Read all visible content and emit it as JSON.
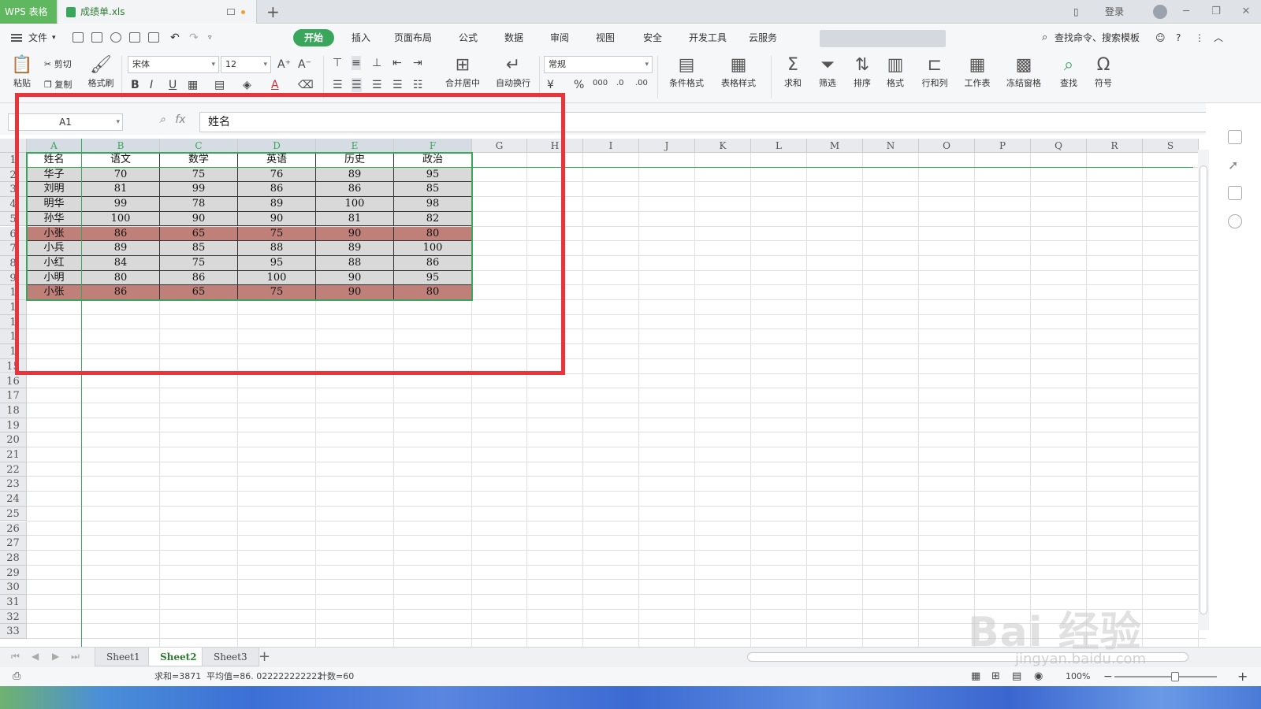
{
  "titlebar": {
    "app_tab": "WPS 表格",
    "doc_tab": "成绩单.xls",
    "login": "登录"
  },
  "menubar": {
    "file": "文件",
    "tabs": [
      "开始",
      "插入",
      "页面布局",
      "公式",
      "数据",
      "审阅",
      "视图",
      "安全",
      "开发工具",
      "云服务"
    ],
    "search": "查找命令、搜索模板"
  },
  "toolbar": {
    "paste": "粘贴",
    "cut": "剪切",
    "copy": "复制",
    "format_painter": "格式刷",
    "font_name": "宋体",
    "font_size": "12",
    "merge_center": "合并居中",
    "wrap_text": "自动换行",
    "number_format": "常规",
    "cond_format": "条件格式",
    "table_style": "表格样式",
    "sum": "求和",
    "filter": "筛选",
    "sort": "排序",
    "format": "格式",
    "row_col": "行和列",
    "worksheet": "工作表",
    "freeze": "冻结窗格",
    "find": "查找",
    "symbol": "符号"
  },
  "formula": {
    "cell_ref": "A1",
    "fx": "fx",
    "content": "姓名"
  },
  "columns": [
    "A",
    "B",
    "C",
    "D",
    "E",
    "F",
    "G",
    "H",
    "I",
    "J",
    "K",
    "L",
    "M",
    "N",
    "O",
    "P",
    "Q",
    "R",
    "S"
  ],
  "rows_visible": [
    "1",
    "2",
    "3",
    "4",
    "5",
    "6",
    "7",
    "8",
    "9",
    "1",
    "1",
    "1",
    "1",
    "1",
    "15",
    "16",
    "17",
    "18",
    "19",
    "20",
    "21",
    "22",
    "23",
    "24",
    "25",
    "26",
    "27",
    "28",
    "29",
    "30",
    "31",
    "32",
    "33"
  ],
  "table": {
    "headers": [
      "姓名",
      "语文",
      "数学",
      "英语",
      "历史",
      "政治"
    ],
    "rows": [
      {
        "cells": [
          "华子",
          "70",
          "75",
          "76",
          "89",
          "95"
        ],
        "highlight": false
      },
      {
        "cells": [
          "刘明",
          "81",
          "99",
          "86",
          "86",
          "85"
        ],
        "highlight": false
      },
      {
        "cells": [
          "明华",
          "99",
          "78",
          "89",
          "100",
          "98"
        ],
        "highlight": false
      },
      {
        "cells": [
          "孙华",
          "100",
          "90",
          "90",
          "81",
          "82"
        ],
        "highlight": false
      },
      {
        "cells": [
          "小张",
          "86",
          "65",
          "75",
          "90",
          "80"
        ],
        "highlight": true
      },
      {
        "cells": [
          "小兵",
          "89",
          "85",
          "88",
          "89",
          "100"
        ],
        "highlight": false
      },
      {
        "cells": [
          "小红",
          "84",
          "75",
          "95",
          "88",
          "86"
        ],
        "highlight": false
      },
      {
        "cells": [
          "小明",
          "80",
          "86",
          "100",
          "90",
          "95"
        ],
        "highlight": false
      },
      {
        "cells": [
          "小张",
          "86",
          "65",
          "75",
          "90",
          "80"
        ],
        "highlight": true
      }
    ]
  },
  "sheets": {
    "tabs": [
      "Sheet1",
      "Sheet2",
      "Sheet3"
    ],
    "active": "Sheet2"
  },
  "status": {
    "sum": "求和=3871",
    "average": "平均值=86. 022222222222",
    "count": "计数=60",
    "zoom": "100%"
  },
  "watermark": {
    "brand": "Bai 经验",
    "url": "jingyan.baidu.com"
  },
  "colors": {
    "accent": "#3aa65b",
    "highlight_row": "#c0807a",
    "data_fill": "#d9d9d9",
    "annotation_frame": "#e8343a"
  }
}
